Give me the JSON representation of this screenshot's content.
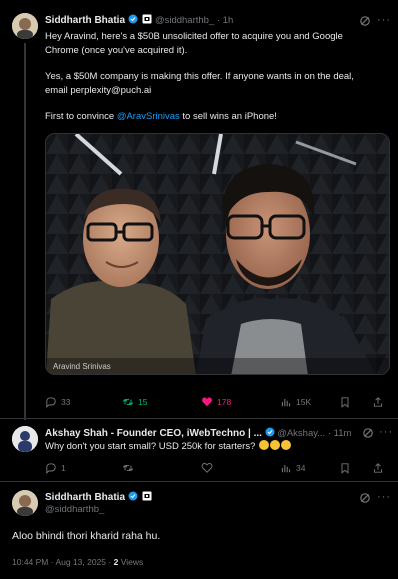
{
  "tweet1": {
    "name": "Siddharth Bhatia",
    "handle": "@siddharthb_",
    "time": "· 1h",
    "text_line1": "Hey Aravind, here's a $50B unsolicited offer to acquire you and Google",
    "text_line2": "Chrome (once you've acquired it).",
    "text_line3": "Yes, a $50M company is making this offer. If anyone wants in on the deal,",
    "text_line4": "email perplexity@puch.ai",
    "text_line5_pre": "First to convince ",
    "text_line5_link": "@AravSrinivas",
    "text_line5_post": " to sell wins an iPhone!",
    "image_caption": "Aravind Srinivas",
    "actions": {
      "replies": "33",
      "reposts": "15",
      "likes": "178",
      "views": "15K"
    }
  },
  "reply": {
    "name": "Akshay Shah - Founder CEO, iWebTechno | ...",
    "handle": "@Akshay...",
    "time": "· 11m",
    "text": "Why don't you start small? USD 250k for starters?",
    "actions": {
      "replies": "1",
      "views": "34"
    }
  },
  "tweet2": {
    "name": "Siddharth Bhatia",
    "handle": "@siddharthb_",
    "text": "Aloo bhindi thori kharid raha hu.",
    "timestamp": "10:44 PM · Aug 13, 2025 · ",
    "views_count": "2",
    "views_label": " Views"
  },
  "colors": {
    "accent": "#1d9bf0",
    "like": "#f91880",
    "repost": "#00ba7c",
    "muted": "#71767b"
  }
}
